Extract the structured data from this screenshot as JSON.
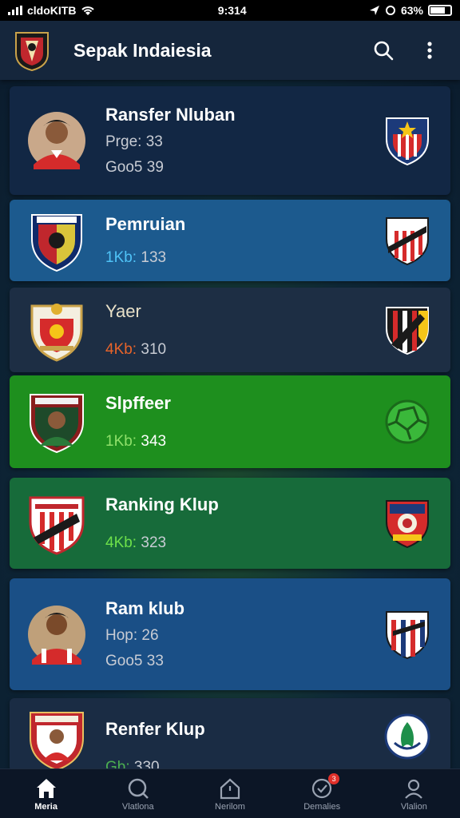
{
  "status_bar": {
    "carrier": "cldoKITB",
    "time": "9:314",
    "battery": "63%"
  },
  "app_bar": {
    "title": "Sepak Indaiesia",
    "search_icon": "search-icon",
    "menu_icon": "more-vert-icon"
  },
  "cards": [
    {
      "title": "Ransfer Nluban",
      "line1": "Prge: 33",
      "line2": "Goo5 39",
      "accent": "#c8ccd4",
      "bg": "#122744"
    },
    {
      "title": "Pemruian",
      "line1": "",
      "line2_prefix": "1Kb:",
      "line2_value": "133",
      "accent": "#4fc3f7",
      "bg": "#1c5a8e"
    },
    {
      "title": "Yaer",
      "line1": "",
      "line2_prefix": "4Kb:",
      "line2_value": "310",
      "accent": "#e8642a",
      "bg": "#1d2e44"
    },
    {
      "title": "Slpffeer",
      "line1": "",
      "line2_prefix": "1Kb:",
      "line2_value": "343",
      "accent": "#8fe06a",
      "bg": "#1e8f1e"
    },
    {
      "title": "Ranking Klup",
      "line1": "",
      "line2_prefix": "4Kb:",
      "line2_value": "323",
      "accent": "#6ee04a",
      "bg": "#176b3a"
    },
    {
      "title": "Ram klub",
      "line1": "Hop: 26",
      "line2": "Goo5 33",
      "accent": "#c8ccd4",
      "bg": "#1a4f86"
    },
    {
      "title": "Renfer Klup",
      "line1": "",
      "line2_prefix": "Gb:",
      "line2_value": "330",
      "accent": "#4caf50",
      "bg": "#1a2c44"
    }
  ],
  "bottom_nav": [
    {
      "label": "Meria",
      "icon": "home-icon",
      "active": true
    },
    {
      "label": "Vlatlona",
      "icon": "search-icon",
      "active": false
    },
    {
      "label": "Nerilom",
      "icon": "house-outline-icon",
      "active": false
    },
    {
      "label": "Demalies",
      "icon": "check-circle-icon",
      "active": false,
      "badge": "3"
    },
    {
      "label": "Vlalion",
      "icon": "person-icon",
      "active": false
    }
  ]
}
